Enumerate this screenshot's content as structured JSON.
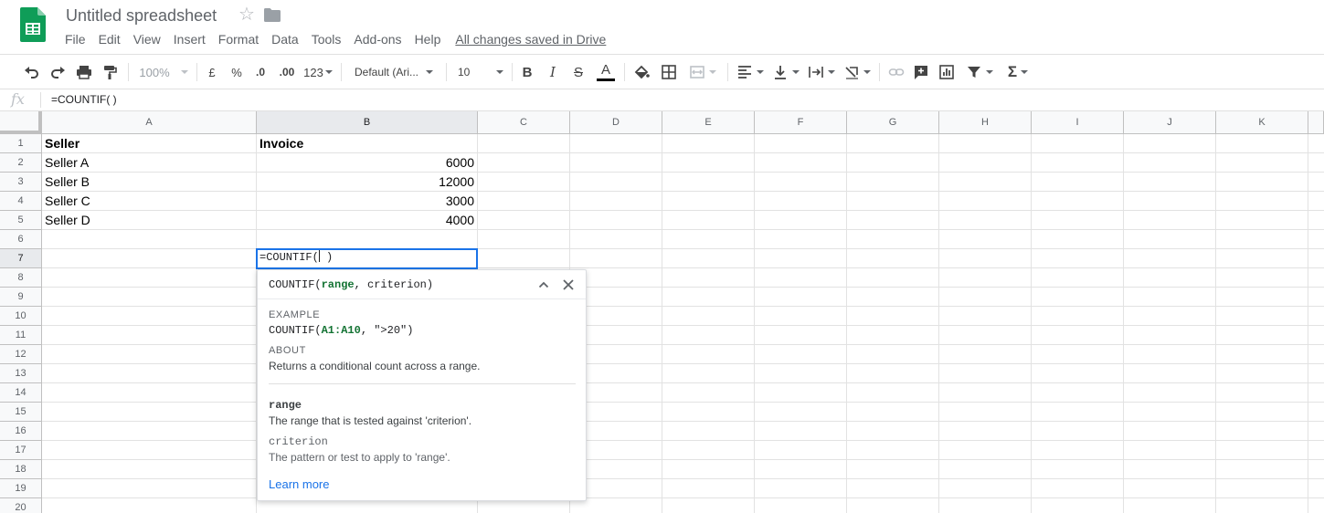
{
  "app": {
    "title": "Untitled spreadsheet",
    "saved_status": "All changes saved in Drive",
    "brand_color": "#0f9d58"
  },
  "menu": [
    "File",
    "Edit",
    "View",
    "Insert",
    "Format",
    "Data",
    "Tools",
    "Add-ons",
    "Help"
  ],
  "toolbar": {
    "zoom": "100%",
    "currency": "£",
    "percent": "%",
    "decrease_decimals": ".0",
    "increase_decimals": ".00",
    "more_formats": "123",
    "font": "Default (Ari...",
    "font_size": "10",
    "bold": "B",
    "italic": "I",
    "strikethrough": "S",
    "text_color": "A",
    "sum": "Σ"
  },
  "formula_bar": {
    "fx": "fx",
    "value": "=COUNTIF( )"
  },
  "columns": [
    "A",
    "B",
    "C",
    "D",
    "E",
    "F",
    "G",
    "H",
    "I",
    "J",
    "K"
  ],
  "rows": [
    "1",
    "2",
    "3",
    "4",
    "5",
    "6",
    "7",
    "8",
    "9",
    "10",
    "11",
    "12",
    "13",
    "14",
    "15",
    "16",
    "17",
    "18",
    "19",
    "20"
  ],
  "cells": {
    "A1": "Seller",
    "B1": "Invoice",
    "A2": "Seller A",
    "B2": "6000",
    "A3": "Seller B",
    "B3": "12000",
    "A4": "Seller C",
    "B4": "3000",
    "A5": "Seller D",
    "B5": "4000",
    "B7_before": "=COUNTIF(",
    "B7_after": " )"
  },
  "formula_help": {
    "signature_name": "COUNTIF(",
    "signature_arg1": "range",
    "signature_sep": ", ",
    "signature_arg2": "criterion",
    "signature_end": ")",
    "example_label": "EXAMPLE",
    "example_name": "COUNTIF(",
    "example_arg": "A1:A10",
    "example_rest": ", \">20\")",
    "about_label": "ABOUT",
    "about_text": "Returns a conditional count across a range.",
    "param1_name": "range",
    "param1_desc": "The range that is tested against 'criterion'.",
    "param2_name": "criterion",
    "param2_desc": "The pattern or test to apply to 'range'.",
    "learn_more": "Learn more"
  }
}
